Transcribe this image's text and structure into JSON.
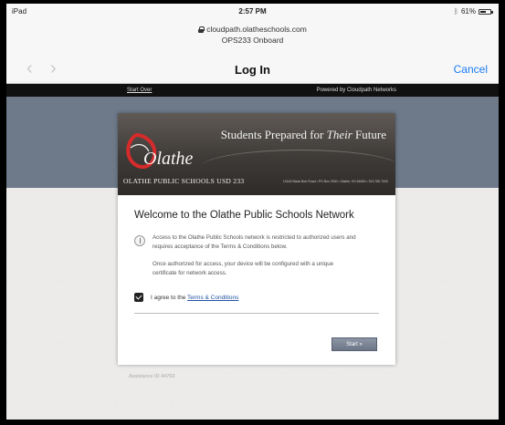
{
  "status_bar": {
    "device": "iPad",
    "time": "2:57 PM",
    "battery": "61%",
    "battery_level": 0.61
  },
  "url_bar": {
    "host": "cloudpath.olatheschools.com",
    "subtitle": "OPS233 Onboard"
  },
  "nav": {
    "back_label": "‹",
    "forward_label": "›",
    "title": "Log In",
    "cancel_label": "Cancel"
  },
  "header": {
    "start_over": "Start Over",
    "powered_by": "Powered by Cloudpath Networks"
  },
  "banner": {
    "logo_text": "Olathe",
    "slogan_pre": "Students Prepared for ",
    "slogan_em": "Their",
    "slogan_post": " Future",
    "district": "OLATHE PUBLIC SCHOOLS USD 233",
    "address": "14160 Black Bob Road • PO Box 2000 • Olathe, KS 66063 • 913.780.7000"
  },
  "card": {
    "welcome": "Welcome to the Olathe Public Schools Network",
    "info_p1": "Access to the Olathe Public Schools network is restricted to authorized users and requires acceptance of the Terms & Conditions below.",
    "info_p2": "Once authorized for access, your device will be configured with a unique certificate for network access.",
    "agree_prefix": "I agree to the ",
    "terms_link": "Terms & Conditions",
    "agree_checked": true,
    "start_label": "Start »"
  },
  "footer": {
    "assistance": "Assistance ID 44763"
  },
  "colors": {
    "accent_blue": "#1a7cf4",
    "link_blue": "#2453a4",
    "slate": "#6e7a8a",
    "header_black": "#111111"
  }
}
